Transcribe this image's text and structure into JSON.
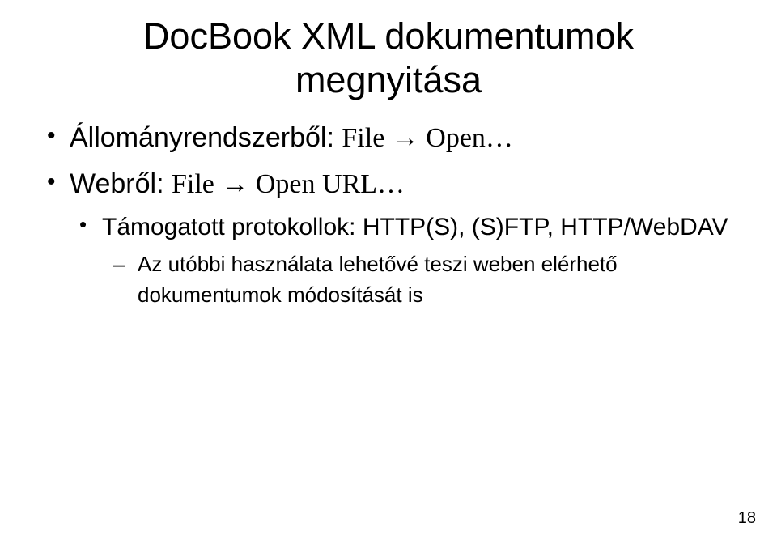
{
  "title_line1": "DocBook XML dokumentumok",
  "title_line2": "megnyitása",
  "bullets": {
    "item1_prefix": "Állományrendszerből: ",
    "item1_serif": "File → Open…",
    "item2_prefix": "Webről: ",
    "item2_serif": "File → Open URL…",
    "item2_sub1": "Támogatott protokollok: HTTP(S), (S)FTP, HTTP/WebDAV",
    "item2_sub1_sub1": "Az utóbbi használata lehetővé teszi weben elérhető dokumentumok módosítását is"
  },
  "page_number": "18"
}
